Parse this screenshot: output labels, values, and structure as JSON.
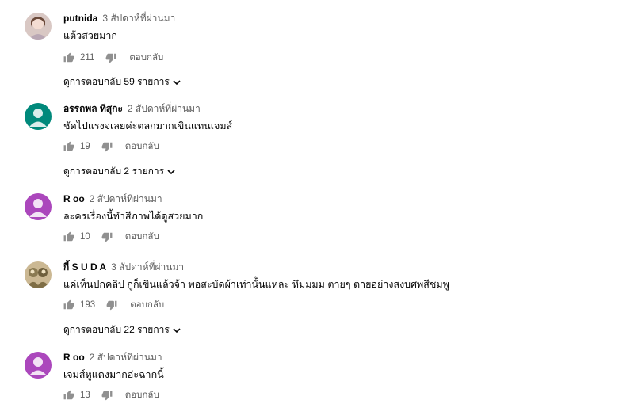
{
  "comments": [
    {
      "author": "putnida",
      "time": "3 สัปดาห์ที่ผ่านมา",
      "text": "แต้วสวยมาก",
      "likes": "211",
      "reply_label": "ตอบกลับ",
      "replies": "ดูการตอบกลับ 59 รายการ",
      "avatar": "photo"
    },
    {
      "author": "อรรถพล ทีสุกะ",
      "time": "2 สัปดาห์ที่ผ่านมา",
      "text": "ชัดไปแรงจเลยค่ะตลกมากเขินแทนเจมส์",
      "likes": "19",
      "reply_label": "ตอบกลับ",
      "replies": "ดูการตอบกลับ 2 รายการ",
      "avatar": "default",
      "avatar_color": "#00897b"
    },
    {
      "author": "R oo",
      "time": "2 สัปดาห์ที่ผ่านมา",
      "text": "ละครเรื่องนี้ทำสีภาพได้ดูสวยมาก",
      "likes": "10",
      "reply_label": "ตอบกลับ",
      "avatar": "default",
      "avatar_color": "#ab47bc"
    },
    {
      "author": "กี้ S U D A",
      "time": "3 สัปดาห์ที่ผ่านมา",
      "text": "แค่เห็นปกคลิป กูก็เขินแล้วจ้า  พอสะบัดผ้าเท่านั้นแหละ หึมมมม ตายๆ ตายอย่างสงบศพสีชมพู",
      "likes": "193",
      "reply_label": "ตอบกลับ",
      "replies": "ดูการตอบกลับ 22 รายการ",
      "avatar": "photo"
    },
    {
      "author": "R oo",
      "time": "2 สัปดาห์ที่ผ่านมา",
      "text": "เจมส์หูแดงมากอ่ะฉากนี้",
      "likes": "13",
      "reply_label": "ตอบกลับ",
      "avatar": "default",
      "avatar_color": "#ab47bc"
    }
  ]
}
